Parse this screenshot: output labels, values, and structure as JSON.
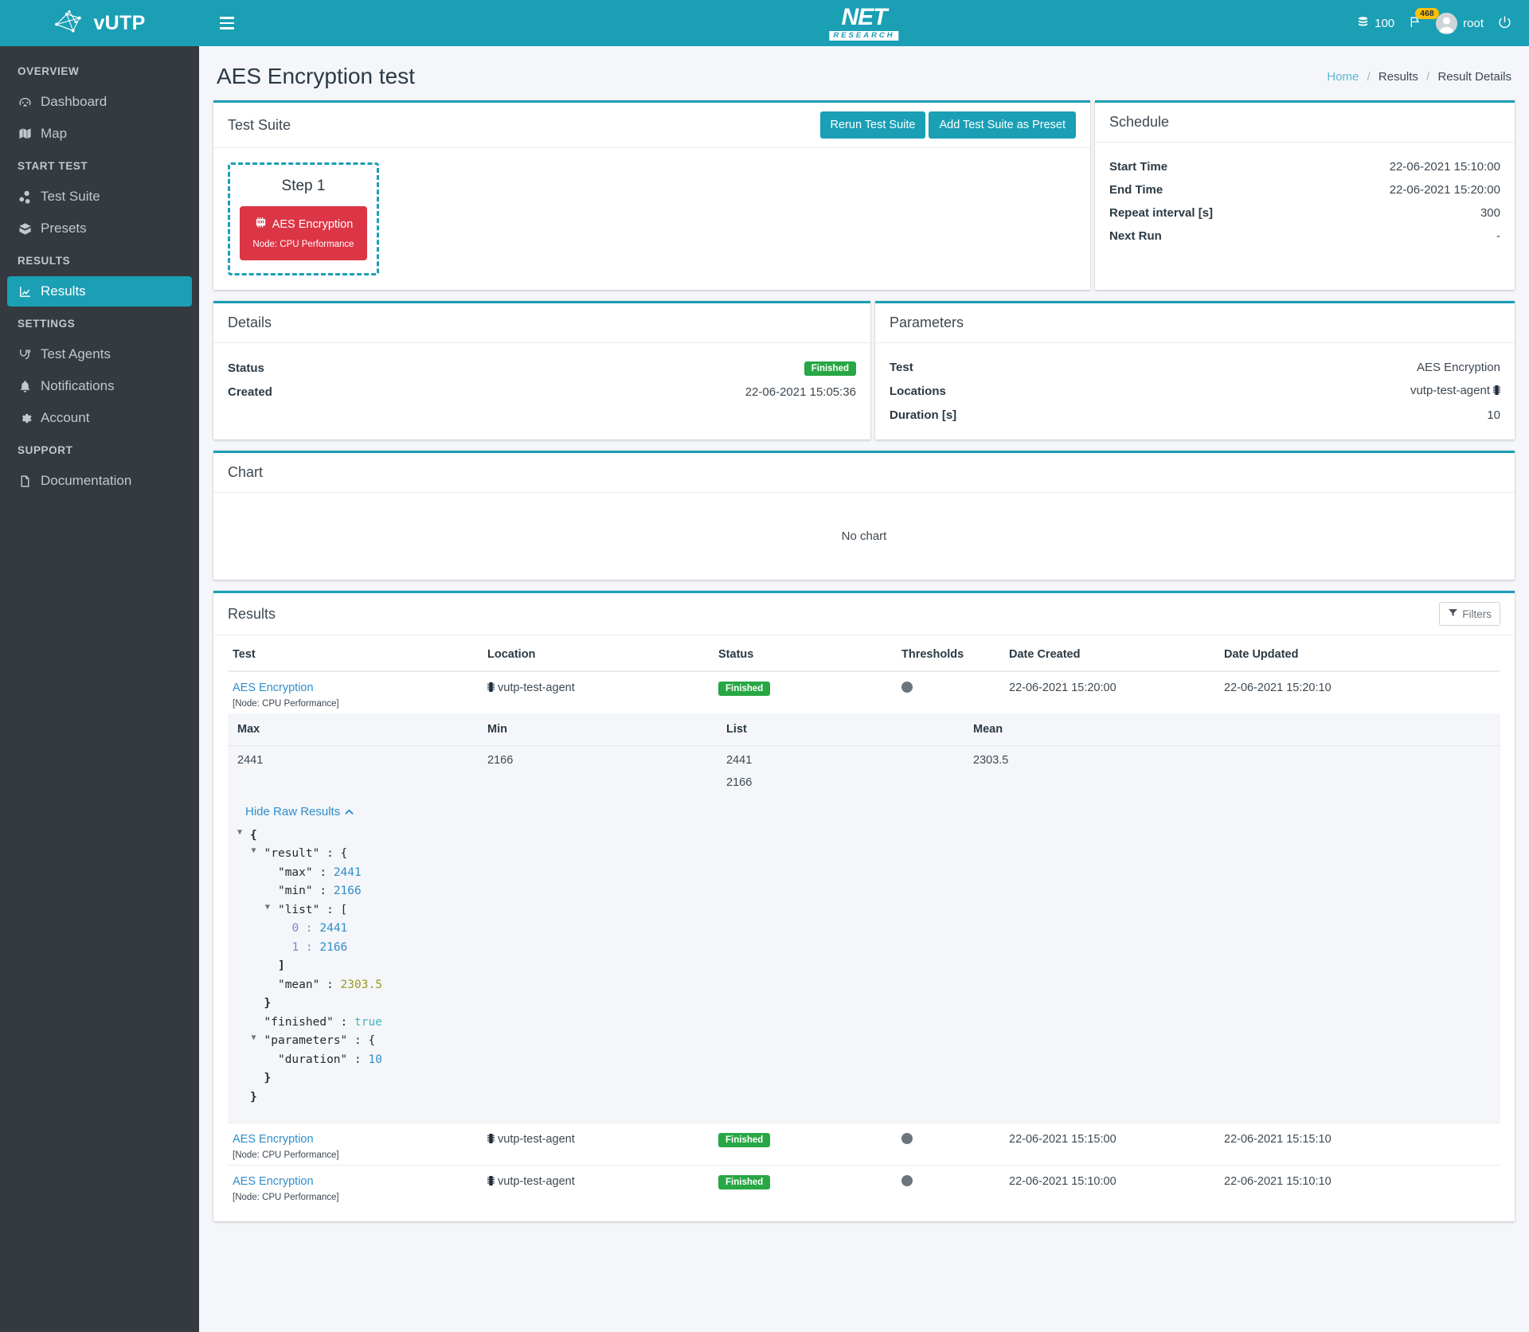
{
  "brand": {
    "name": "vUTP",
    "logo_icon": "network-logo-icon"
  },
  "sidebar": {
    "sections": [
      {
        "header": "OVERVIEW",
        "items": [
          {
            "label": "Dashboard",
            "icon": "dashboard-icon",
            "active": false
          },
          {
            "label": "Map",
            "icon": "map-icon",
            "active": false
          }
        ]
      },
      {
        "header": "START TEST",
        "items": [
          {
            "label": "Test Suite",
            "icon": "test-suite-icon",
            "active": false
          },
          {
            "label": "Presets",
            "icon": "presets-box-icon",
            "active": false
          }
        ]
      },
      {
        "header": "RESULTS",
        "items": [
          {
            "label": "Results",
            "icon": "chart-line-icon",
            "active": true
          }
        ]
      },
      {
        "header": "SETTINGS",
        "items": [
          {
            "label": "Test Agents",
            "icon": "test-agents-icon",
            "active": false
          },
          {
            "label": "Notifications",
            "icon": "bell-icon",
            "active": false
          },
          {
            "label": "Account",
            "icon": "gear-icon",
            "active": false
          }
        ]
      },
      {
        "header": "SUPPORT",
        "items": [
          {
            "label": "Documentation",
            "icon": "document-icon",
            "active": false
          }
        ]
      }
    ]
  },
  "topbar": {
    "menu_icon": "hamburger-icon",
    "logo_word": "NET",
    "logo_sub": "RESEARCH",
    "credits_icon": "database-icon",
    "credits": "100",
    "flag_icon": "flag-icon",
    "flag_badge": "468",
    "username": "root",
    "power_icon": "power-icon"
  },
  "page": {
    "title": "AES Encryption test",
    "breadcrumb": {
      "home": "Home",
      "results": "Results",
      "current": "Result Details",
      "separator": "/"
    }
  },
  "test_suite": {
    "title": "Test Suite",
    "rerun_label": "Rerun Test Suite",
    "preset_label": "Add Test Suite as Preset",
    "step": {
      "label": "Step 1",
      "block_title": "AES Encryption",
      "block_icon": "memory-chip-icon",
      "block_sub": "Node: CPU Performance"
    }
  },
  "schedule": {
    "title": "Schedule",
    "rows": [
      {
        "key": "Start Time",
        "value": "22-06-2021 15:10:00"
      },
      {
        "key": "End Time",
        "value": "22-06-2021 15:20:00"
      },
      {
        "key": "Repeat interval [s]",
        "value": "300"
      },
      {
        "key": "Next Run",
        "value": "-"
      }
    ]
  },
  "details": {
    "title": "Details",
    "status_key": "Status",
    "status_value": "Finished",
    "created_key": "Created",
    "created_value": "22-06-2021 15:05:36"
  },
  "parameters": {
    "title": "Parameters",
    "rows": [
      {
        "key": "Test",
        "value": "AES Encryption",
        "icon": ""
      },
      {
        "key": "Locations",
        "value": "vutp-test-agent",
        "icon": "memory-chip-icon"
      },
      {
        "key": "Duration [s]",
        "value": "10",
        "icon": ""
      }
    ]
  },
  "chart": {
    "title": "Chart",
    "empty_text": "No chart"
  },
  "results": {
    "title": "Results",
    "filters_label": "Filters",
    "filters_icon": "filter-funnel-icon",
    "columns": [
      "Test",
      "Location",
      "Status",
      "Thresholds",
      "Date Created",
      "Date Updated"
    ],
    "rows": [
      {
        "test": "AES Encryption",
        "node": "[Node: CPU Performance]",
        "location": "vutp-test-agent",
        "location_icon": "memory-chip-icon",
        "status": "Finished",
        "threshold_icon": "gray-circle-icon",
        "date_created": "22-06-2021 15:20:00",
        "date_updated": "22-06-2021 15:20:10",
        "expanded": true,
        "metrics": {
          "columns": [
            "Max",
            "Min",
            "List",
            "Mean"
          ],
          "max": "2441",
          "min": "2166",
          "list": [
            "2441",
            "2166"
          ],
          "mean": "2303.5"
        },
        "raw_toggle_label": "Hide Raw Results",
        "raw_toggle_icon": "chevron-up-icon",
        "raw": {
          "result": {
            "max": 2441,
            "min": 2166,
            "list": [
              2441,
              2166
            ],
            "mean": 2303.5
          },
          "finished": true,
          "parameters": {
            "duration": 10
          }
        }
      },
      {
        "test": "AES Encryption",
        "node": "[Node: CPU Performance]",
        "location": "vutp-test-agent",
        "location_icon": "memory-chip-icon",
        "status": "Finished",
        "threshold_icon": "gray-circle-icon",
        "date_created": "22-06-2021 15:15:00",
        "date_updated": "22-06-2021 15:15:10",
        "expanded": false
      },
      {
        "test": "AES Encryption",
        "node": "[Node: CPU Performance]",
        "location": "vutp-test-agent",
        "location_icon": "memory-chip-icon",
        "status": "Finished",
        "threshold_icon": "gray-circle-icon",
        "date_created": "22-06-2021 15:10:00",
        "date_updated": "22-06-2021 15:10:10",
        "expanded": false
      }
    ]
  },
  "colors": {
    "accent": "#1a9fb5",
    "sidebar": "#343a40",
    "danger": "#dc3545",
    "success": "#28a745",
    "badge": "#ffc107",
    "link": "#2f8ecb"
  },
  "json_lines": [
    {
      "indent": 0,
      "tri": true,
      "text": "{",
      "cls": "j-punc"
    },
    {
      "indent": 1,
      "tri": true,
      "text": "\"result\" : {",
      "cls": "j-key"
    },
    {
      "indent": 2,
      "tri": false,
      "key": "\"max\" : ",
      "val": "2441",
      "vcls": "j-num"
    },
    {
      "indent": 2,
      "tri": false,
      "key": "\"min\" : ",
      "val": "2166",
      "vcls": "j-num"
    },
    {
      "indent": 2,
      "tri": true,
      "text": "\"list\" : [",
      "cls": "j-key"
    },
    {
      "indent": 3,
      "tri": false,
      "key": "0 : ",
      "kcls": "j-idx",
      "val": "2441",
      "vcls": "j-num"
    },
    {
      "indent": 3,
      "tri": false,
      "key": "1 : ",
      "kcls": "j-idx",
      "val": "2166",
      "vcls": "j-num"
    },
    {
      "indent": 2,
      "tri": false,
      "text": "]",
      "cls": "j-punc"
    },
    {
      "indent": 2,
      "tri": false,
      "key": "\"mean\" : ",
      "val": "2303.5",
      "vcls": "j-float"
    },
    {
      "indent": 1,
      "tri": false,
      "text": "}",
      "cls": "j-punc"
    },
    {
      "indent": 1,
      "tri": false,
      "key": "\"finished\" : ",
      "val": "true",
      "vcls": "j-bool"
    },
    {
      "indent": 1,
      "tri": true,
      "text": "\"parameters\" : {",
      "cls": "j-key"
    },
    {
      "indent": 2,
      "tri": false,
      "key": "\"duration\" : ",
      "val": "10",
      "vcls": "j-num"
    },
    {
      "indent": 1,
      "tri": false,
      "text": "}",
      "cls": "j-punc"
    },
    {
      "indent": 0,
      "tri": false,
      "text": "}",
      "cls": "j-punc"
    }
  ]
}
